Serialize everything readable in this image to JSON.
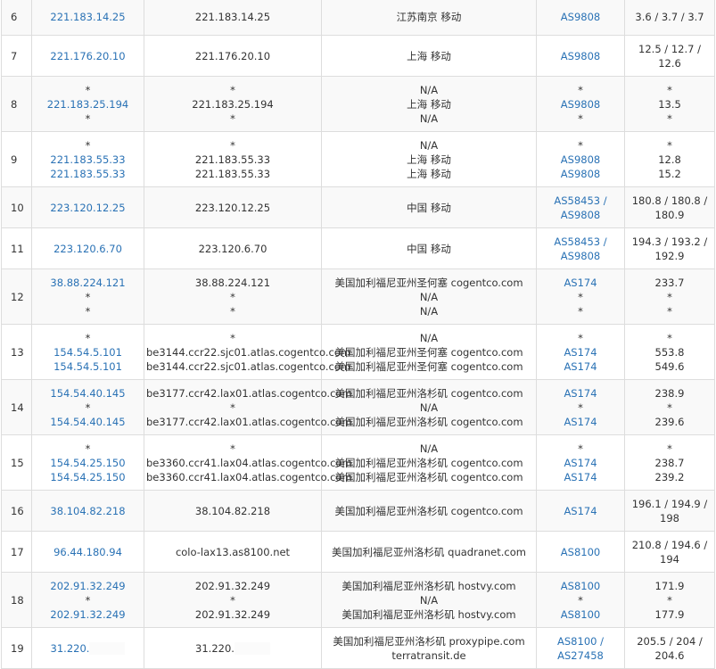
{
  "rows": [
    {
      "hop": "6",
      "ips": [
        "221.183.14.25"
      ],
      "hosts": [
        "221.183.14.25"
      ],
      "locs": [
        "江苏南京 移动"
      ],
      "asns": [
        "AS9808"
      ],
      "times": [
        "3.6 / 3.7 / 3.7"
      ],
      "h": 42
    },
    {
      "hop": "7",
      "ips": [
        "221.176.20.10"
      ],
      "hosts": [
        "221.176.20.10"
      ],
      "locs": [
        "上海 移动"
      ],
      "asns": [
        "AS9808"
      ],
      "times": [
        "12.5 / 12.7 /",
        "12.6"
      ],
      "h": 46
    },
    {
      "hop": "8",
      "ips": [
        "*",
        "221.183.25.194",
        "*"
      ],
      "hosts": [
        "*",
        "221.183.25.194",
        "*"
      ],
      "locs": [
        "N/A",
        "上海 移动",
        "N/A"
      ],
      "asns": [
        "*",
        "AS9808",
        "*"
      ],
      "times": [
        "*",
        "13.5",
        "*"
      ],
      "h": 62
    },
    {
      "hop": "9",
      "ips": [
        "*",
        "221.183.55.33",
        "221.183.55.33"
      ],
      "hosts": [
        "*",
        "221.183.55.33",
        "221.183.55.33"
      ],
      "locs": [
        "N/A",
        "上海 移动",
        "上海 移动"
      ],
      "asns": [
        "*",
        "AS9808",
        "AS9808"
      ],
      "times": [
        "*",
        "12.8",
        "15.2"
      ],
      "h": 62
    },
    {
      "hop": "10",
      "ips": [
        "223.120.12.25"
      ],
      "hosts": [
        "223.120.12.25"
      ],
      "locs": [
        "中国 移动"
      ],
      "asns": [
        "AS58453 /",
        "AS9808"
      ],
      "times": [
        "180.8 / 180.8 /",
        "180.9"
      ],
      "h": 46
    },
    {
      "hop": "11",
      "ips": [
        "223.120.6.70"
      ],
      "hosts": [
        "223.120.6.70"
      ],
      "locs": [
        "中国 移动"
      ],
      "asns": [
        "AS58453 /",
        "AS9808"
      ],
      "times": [
        "194.3 / 193.2 /",
        "192.9"
      ],
      "h": 46
    },
    {
      "hop": "12",
      "ips": [
        "38.88.224.121",
        "*",
        "*"
      ],
      "hosts": [
        "38.88.224.121",
        "*",
        "*"
      ],
      "locs": [
        "美国加利福尼亚州圣何塞 cogentco.com",
        "N/A",
        "N/A"
      ],
      "asns": [
        "AS174",
        "*",
        "*"
      ],
      "times": [
        "233.7",
        "*",
        "*"
      ],
      "h": 62
    },
    {
      "hop": "13",
      "ips": [
        "*",
        "154.54.5.101",
        "154.54.5.101"
      ],
      "hosts": [
        "*",
        "be3144.ccr22.sjc01.atlas.cogentco.com",
        "be3144.ccr22.sjc01.atlas.cogentco.com"
      ],
      "locs": [
        "N/A",
        "美国加利福尼亚州圣何塞 cogentco.com",
        "美国加利福尼亚州圣何塞 cogentco.com"
      ],
      "asns": [
        "*",
        "AS174",
        "AS174"
      ],
      "times": [
        "*",
        "553.8",
        "549.6"
      ],
      "h": 62
    },
    {
      "hop": "14",
      "ips": [
        "154.54.40.145",
        "*",
        "154.54.40.145"
      ],
      "hosts": [
        "be3177.ccr42.lax01.atlas.cogentco.com",
        "*",
        "be3177.ccr42.lax01.atlas.cogentco.com"
      ],
      "locs": [
        "美国加利福尼亚州洛杉矶 cogentco.com",
        "N/A",
        "美国加利福尼亚州洛杉矶 cogentco.com"
      ],
      "asns": [
        "AS174",
        "*",
        "AS174"
      ],
      "times": [
        "238.9",
        "*",
        "239.6"
      ],
      "h": 62
    },
    {
      "hop": "15",
      "ips": [
        "*",
        "154.54.25.150",
        "154.54.25.150"
      ],
      "hosts": [
        "*",
        "be3360.ccr41.lax04.atlas.cogentco.com",
        "be3360.ccr41.lax04.atlas.cogentco.com"
      ],
      "locs": [
        "N/A",
        "美国加利福尼亚州洛杉矶 cogentco.com",
        "美国加利福尼亚州洛杉矶 cogentco.com"
      ],
      "asns": [
        "*",
        "AS174",
        "AS174"
      ],
      "times": [
        "*",
        "238.7",
        "239.2"
      ],
      "h": 62
    },
    {
      "hop": "16",
      "ips": [
        "38.104.82.218"
      ],
      "hosts": [
        "38.104.82.218"
      ],
      "locs": [
        "美国加利福尼亚州洛杉矶 cogentco.com"
      ],
      "asns": [
        "AS174"
      ],
      "times": [
        "196.1 / 194.9 /",
        "198"
      ],
      "h": 46
    },
    {
      "hop": "17",
      "ips": [
        "96.44.180.94"
      ],
      "hosts": [
        "colo-lax13.as8100.net"
      ],
      "locs": [
        "美国加利福尼亚州洛杉矶 quadranet.com"
      ],
      "asns": [
        "AS8100"
      ],
      "times": [
        "210.8 / 194.6 /",
        "194"
      ],
      "h": 46
    },
    {
      "hop": "18",
      "ips": [
        "202.91.32.249",
        "*",
        "202.91.32.249"
      ],
      "hosts": [
        "202.91.32.249",
        "*",
        "202.91.32.249"
      ],
      "locs": [
        "美国加利福尼亚州洛杉矶 hostvy.com",
        "N/A",
        "美国加利福尼亚州洛杉矶 hostvy.com"
      ],
      "asns": [
        "AS8100",
        "*",
        "AS8100"
      ],
      "times": [
        "171.9",
        "*",
        "177.9"
      ],
      "h": 62
    },
    {
      "hop": "19",
      "ips": [
        "31.220."
      ],
      "hosts": [
        "31.220."
      ],
      "locs": [
        "美国加利福尼亚州洛杉矶 proxypipe.com",
        "terratransit.de"
      ],
      "asns": [
        "AS8100 /",
        "AS27458"
      ],
      "times": [
        "205.5 / 204 /",
        "204.6"
      ],
      "h": 46
    }
  ]
}
